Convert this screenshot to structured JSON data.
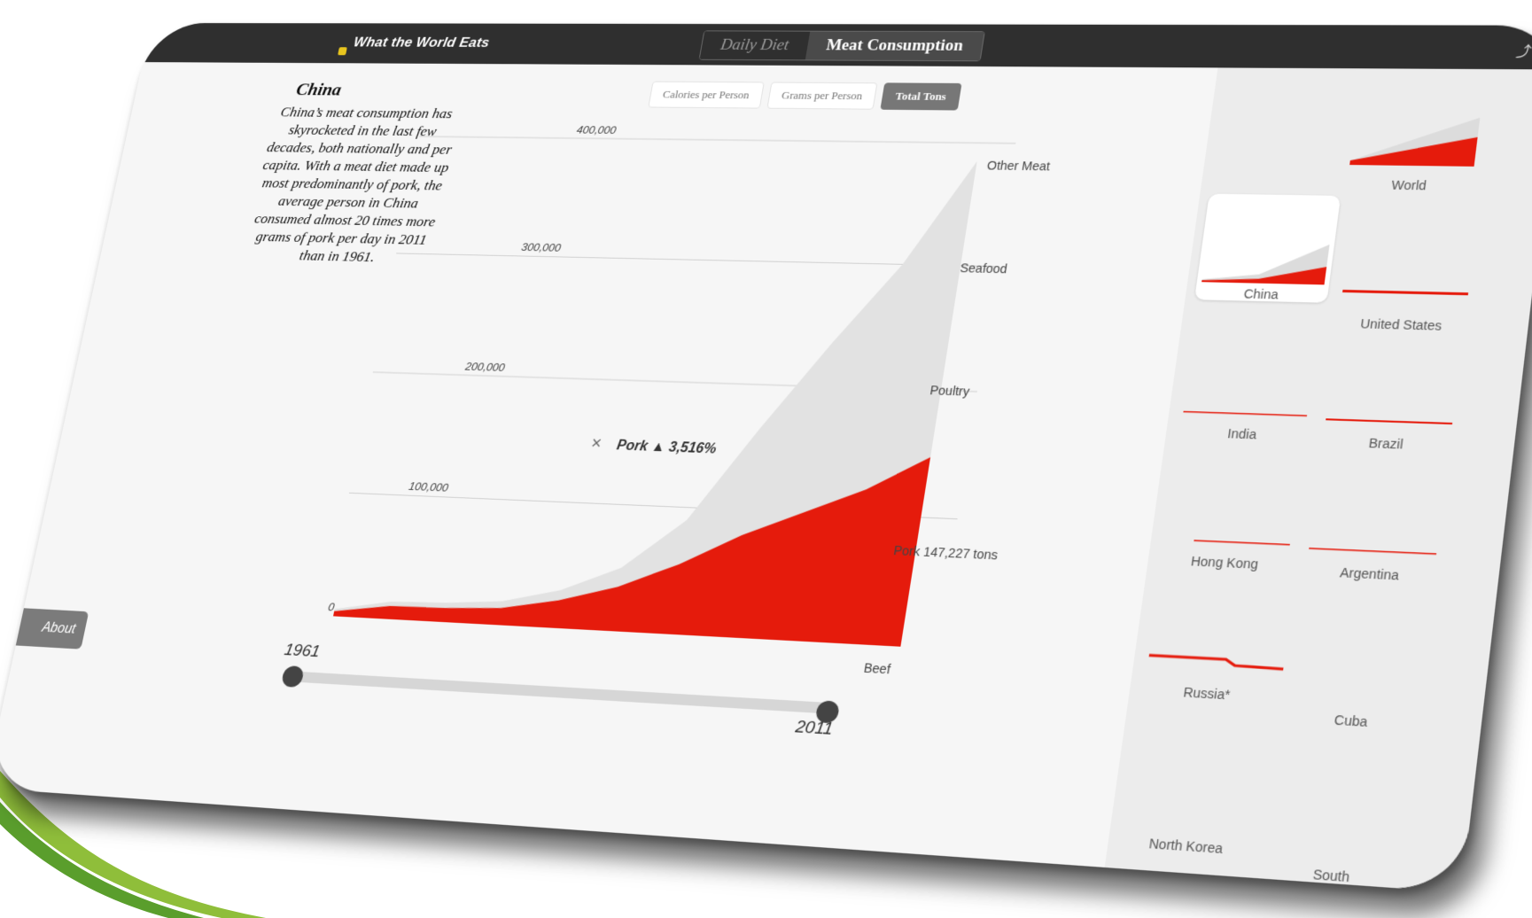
{
  "app": {
    "title": "What the World Eats",
    "view_tabs": [
      {
        "label": "Daily Diet",
        "active": false
      },
      {
        "label": "Meat Consumption",
        "active": true
      }
    ]
  },
  "country": {
    "name": "China",
    "description": "China’s meat consumption has skyrocketed in the last few decades, both nationally and per capita. With a meat diet made up most predominantly of pork, the average person in China consumed almost 20 times more grams of pork per day in 2011 than in 1961."
  },
  "unit_tabs": [
    {
      "label": "Calories per Person",
      "active": false
    },
    {
      "label": "Grams per Person",
      "active": false
    },
    {
      "label": "Total Tons",
      "active": true
    }
  ],
  "tooltip": {
    "close_symbol": "×",
    "label": "Pork ▲ 3,516%"
  },
  "chart_data": {
    "type": "area",
    "ylim": [
      0,
      400000
    ],
    "yticks": [
      0,
      100000,
      200000,
      300000,
      400000
    ],
    "ytick_labels": [
      "0",
      "100,000",
      "200,000",
      "300,000",
      "400,000"
    ],
    "x": [
      1961,
      1966,
      1971,
      1976,
      1981,
      1986,
      1991,
      1996,
      2001,
      2006,
      2011
    ],
    "series": [
      {
        "name": "Pork",
        "color": "#e51b0c",
        "values": [
          4100,
          10500,
          11200,
          13500,
          22000,
          35000,
          55000,
          80000,
          100000,
          120000,
          147227
        ]
      },
      {
        "name": "Other Meat",
        "color": "#e2e2e2",
        "values": [
          5800,
          14000,
          15500,
          19000,
          30000,
          50000,
          90000,
          165000,
          235000,
          300000,
          385000
        ]
      }
    ],
    "end_labels": [
      "Other Meat",
      "Seafood",
      "Poultry",
      "Pork 147,227 tons",
      "Beef"
    ],
    "grid": true
  },
  "slider": {
    "start_label": "1961",
    "end_label": "2011"
  },
  "about_label": "About",
  "sidebar": {
    "items": [
      {
        "label": "World"
      },
      {
        "label": "China",
        "selected": true
      },
      {
        "label": "United States"
      },
      {
        "label": "India"
      },
      {
        "label": "Brazil"
      },
      {
        "label": "Hong Kong"
      },
      {
        "label": "Argentina"
      },
      {
        "label": "Russia*"
      },
      {
        "label": "Cuba"
      },
      {
        "label": "North Korea"
      },
      {
        "label": "South"
      }
    ]
  },
  "colors": {
    "pork": "#e51b0c",
    "other": "#e2e2e2",
    "bar": "#2f2f2f"
  }
}
